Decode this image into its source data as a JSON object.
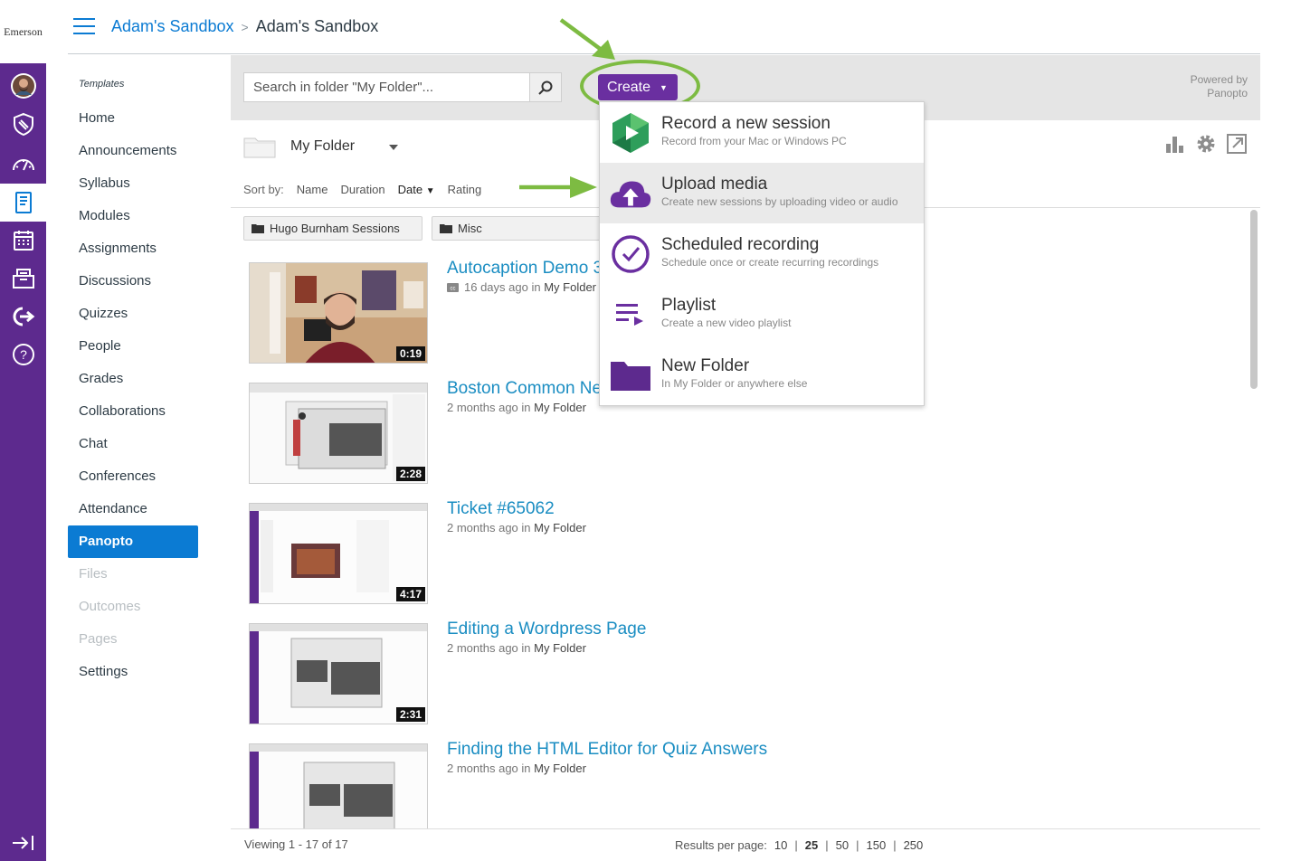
{
  "brand": "Emerson",
  "global_nav": {
    "items": [
      {
        "icon": "avatar-icon",
        "label": "Account"
      },
      {
        "icon": "shield-badge-icon",
        "label": "Admin"
      },
      {
        "icon": "dashboard-icon",
        "label": "Dashboard"
      },
      {
        "icon": "courses-icon",
        "label": "Courses"
      },
      {
        "icon": "calendar-icon",
        "label": "Calendar"
      },
      {
        "icon": "inbox-icon",
        "label": "Inbox"
      },
      {
        "icon": "commons-icon",
        "label": "Commons"
      },
      {
        "icon": "help-icon",
        "label": "Help"
      }
    ],
    "collapse_icon": "collapse-nav-icon"
  },
  "header": {
    "crumb_link": "Adam's Sandbox",
    "crumb_sep": ">",
    "crumb_current": "Adam's Sandbox"
  },
  "course_nav": {
    "templates_label": "Templates",
    "items": [
      {
        "label": "Home"
      },
      {
        "label": "Announcements"
      },
      {
        "label": "Syllabus"
      },
      {
        "label": "Modules"
      },
      {
        "label": "Assignments"
      },
      {
        "label": "Discussions"
      },
      {
        "label": "Quizzes"
      },
      {
        "label": "People"
      },
      {
        "label": "Grades"
      },
      {
        "label": "Collaborations"
      },
      {
        "label": "Chat"
      },
      {
        "label": "Conferences"
      },
      {
        "label": "Attendance"
      },
      {
        "label": "Panopto"
      },
      {
        "label": "Files"
      },
      {
        "label": "Outcomes"
      },
      {
        "label": "Pages"
      },
      {
        "label": "Settings"
      }
    ]
  },
  "panopto": {
    "search_placeholder": "Search in folder \"My Folder\"...",
    "create_label": "Create",
    "powered_by": "Powered by Panopto",
    "folder_name": "My Folder",
    "sort_label": "Sort by:",
    "sort_options": [
      "Name",
      "Duration",
      "Date",
      "Rating"
    ],
    "sort_active": "Date",
    "subfolders": [
      "Hugo Burnham Sessions",
      "Misc"
    ],
    "sessions": [
      {
        "title": "Autocaption Demo 3",
        "age": "16 days ago",
        "in": "in",
        "folder": "My Folder",
        "duration": "0:19",
        "captioned": true
      },
      {
        "title": "Boston Common New",
        "age": "2 months ago",
        "in": "in",
        "folder": "My Folder",
        "duration": "2:28"
      },
      {
        "title": "Ticket #65062",
        "age": "2 months ago",
        "in": "in",
        "folder": "My Folder",
        "duration": "4:17"
      },
      {
        "title": "Editing a Wordpress Page",
        "age": "2 months ago",
        "in": "in",
        "folder": "My Folder",
        "duration": "2:31"
      },
      {
        "title": "Finding the HTML Editor for Quiz Answers",
        "age": "2 months ago",
        "in": "in",
        "folder": "My Folder",
        "duration": ""
      }
    ],
    "create_menu": [
      {
        "title": "Record a new session",
        "subtitle": "Record from your Mac or Windows PC",
        "icon": "panopto-record-icon"
      },
      {
        "title": "Upload media",
        "subtitle": "Create new sessions by uploading video or audio",
        "icon": "cloud-upload-icon"
      },
      {
        "title": "Scheduled recording",
        "subtitle": "Schedule once or create recurring recordings",
        "icon": "clock-icon"
      },
      {
        "title": "Playlist",
        "subtitle": "Create a new video playlist",
        "icon": "playlist-icon"
      },
      {
        "title": "New Folder",
        "subtitle": "In My Folder or anywhere else",
        "icon": "folder-icon"
      }
    ],
    "footer": {
      "viewing": "Viewing 1 - 17 of 17",
      "per_page_label": "Results per page:",
      "per_page_options": [
        "10",
        "25",
        "50",
        "150",
        "250"
      ],
      "per_page_active": "25"
    }
  },
  "colors": {
    "global_nav": "#5d2a8e",
    "link": "#0b7bd3",
    "create_button": "#6a2fa0",
    "highlight_ring": "#7dbb42",
    "session_title": "#1a8dc2"
  }
}
